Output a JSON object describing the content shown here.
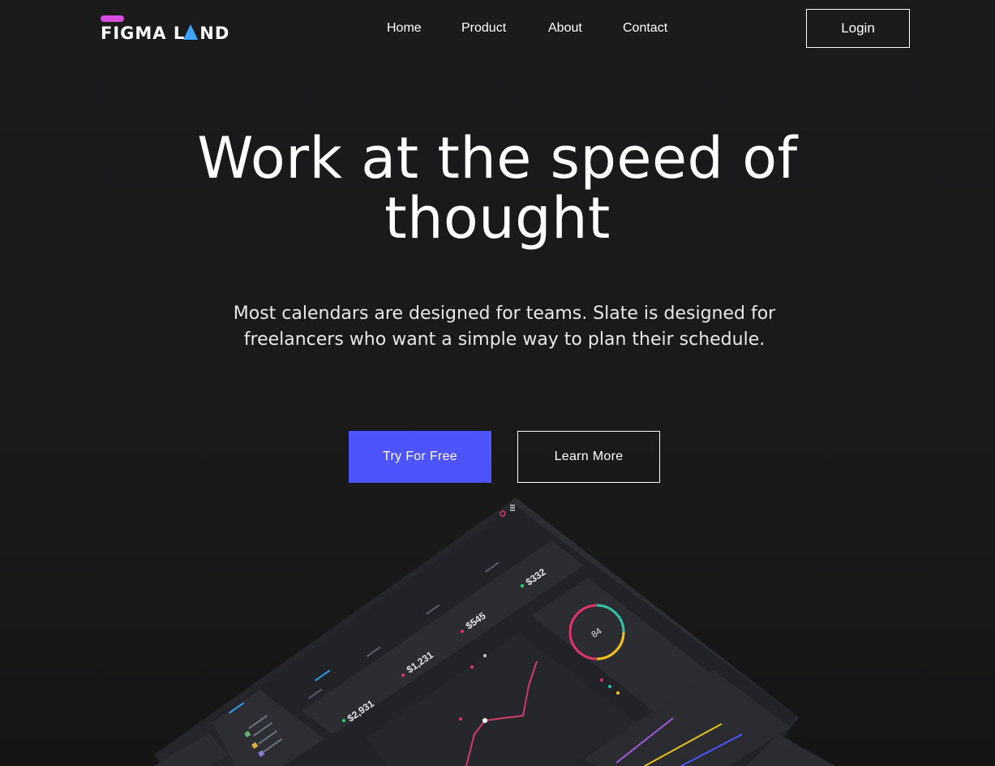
{
  "brand": {
    "logo_text": "FIGMA L",
    "logo_text_end": "ND",
    "accent_color": "#d64cdf",
    "tri_color": "#3ea4ff"
  },
  "nav": {
    "items": [
      {
        "label": "Home"
      },
      {
        "label": "Product"
      },
      {
        "label": "About"
      },
      {
        "label": "Contact"
      }
    ],
    "login_label": "Login"
  },
  "hero": {
    "headline_line1": "Work at the speed of",
    "headline_line2": "thought",
    "subhead_line1": "Most calendars are designed for teams. Slate is designed for",
    "subhead_line2": "freelancers who want a simple way to plan their schedule.",
    "primary_cta": "Try For Free",
    "secondary_cta": "Learn More",
    "primary_color": "#4d54fb"
  },
  "mockup": {
    "stats": [
      "$2,931",
      "$1,231",
      "$545",
      "$332"
    ],
    "gauge_value": "84"
  }
}
